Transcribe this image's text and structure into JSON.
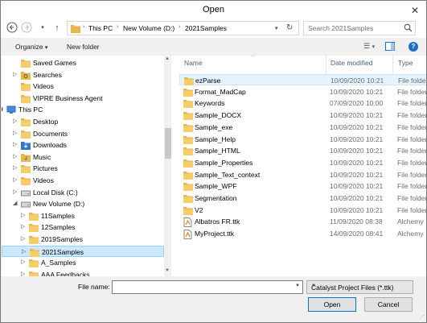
{
  "window": {
    "title": "Open"
  },
  "nav": {
    "breadcrumbs": [
      "This PC",
      "New Volume (D:)",
      "2021Samples"
    ],
    "search_placeholder": "Search 2021Samples"
  },
  "toolbar": {
    "organize_label": "Organize",
    "new_folder_label": "New folder"
  },
  "tree": {
    "items": [
      {
        "label": "Saved Games",
        "icon": "folder-icon",
        "indent": 2,
        "arrow": ""
      },
      {
        "label": "Searches",
        "icon": "search-folder-icon",
        "indent": 2,
        "arrow": "right"
      },
      {
        "label": "Videos",
        "icon": "folder-icon",
        "indent": 2,
        "arrow": ""
      },
      {
        "label": "VIPRE Business Agent",
        "icon": "folder-icon",
        "indent": 2,
        "arrow": ""
      },
      {
        "label": "This PC",
        "icon": "pc-icon",
        "indent": 1,
        "arrow": "down"
      },
      {
        "label": "Desktop",
        "icon": "folder-icon",
        "indent": 2,
        "arrow": "right"
      },
      {
        "label": "Documents",
        "icon": "folder-icon",
        "indent": 2,
        "arrow": "right"
      },
      {
        "label": "Downloads",
        "icon": "download-folder-icon",
        "indent": 2,
        "arrow": "right"
      },
      {
        "label": "Music",
        "icon": "music-folder-icon",
        "indent": 2,
        "arrow": "right"
      },
      {
        "label": "Pictures",
        "icon": "folder-icon",
        "indent": 2,
        "arrow": "right"
      },
      {
        "label": "Videos",
        "icon": "folder-icon",
        "indent": 2,
        "arrow": "right"
      },
      {
        "label": "Local Disk (C:)",
        "icon": "drive-icon",
        "indent": 2,
        "arrow": "right"
      },
      {
        "label": "New Volume (D:)",
        "icon": "drive-icon",
        "indent": 2,
        "arrow": "down"
      },
      {
        "label": "11Samples",
        "icon": "folder-icon",
        "indent": 3,
        "arrow": "right"
      },
      {
        "label": "12Samples",
        "icon": "folder-icon",
        "indent": 3,
        "arrow": "right"
      },
      {
        "label": "2019Samples",
        "icon": "folder-icon",
        "indent": 3,
        "arrow": "right"
      },
      {
        "label": "2021Samples",
        "icon": "folder-icon",
        "indent": 3,
        "arrow": "right",
        "selected": true
      },
      {
        "label": "A_Samples",
        "icon": "folder-icon",
        "indent": 3,
        "arrow": "right"
      },
      {
        "label": "AAA Feedbacks",
        "icon": "folder-icon",
        "indent": 3,
        "arrow": "right"
      }
    ]
  },
  "list": {
    "columns": [
      "Name",
      "Date modified",
      "Type"
    ],
    "files": [
      {
        "name": "ezParse",
        "date": "10/09/2020 10:21",
        "type": "File folder",
        "icon": "folder-icon",
        "selected": true
      },
      {
        "name": "Format_MadCap",
        "date": "10/09/2020 10:21",
        "type": "File folder",
        "icon": "folder-icon"
      },
      {
        "name": "Keywords",
        "date": "07/09/2020 10:00",
        "type": "File folder",
        "icon": "folder-icon"
      },
      {
        "name": "Sample_DOCX",
        "date": "10/09/2020 10:21",
        "type": "File folder",
        "icon": "folder-icon"
      },
      {
        "name": "Sample_exe",
        "date": "10/09/2020 10:21",
        "type": "File folder",
        "icon": "folder-icon"
      },
      {
        "name": "Sample_Help",
        "date": "10/09/2020 10:21",
        "type": "File folder",
        "icon": "folder-icon"
      },
      {
        "name": "Sample_HTML",
        "date": "10/09/2020 10:21",
        "type": "File folder",
        "icon": "folder-icon"
      },
      {
        "name": "Sample_Properties",
        "date": "10/09/2020 10:21",
        "type": "File folder",
        "icon": "folder-icon"
      },
      {
        "name": "Sample_Text_context",
        "date": "10/09/2020 10:21",
        "type": "File folder",
        "icon": "folder-icon"
      },
      {
        "name": "Sample_WPF",
        "date": "10/09/2020 10:21",
        "type": "File folder",
        "icon": "folder-icon"
      },
      {
        "name": "Segmentation",
        "date": "10/09/2020 10:21",
        "type": "File folder",
        "icon": "folder-icon"
      },
      {
        "name": "V2",
        "date": "10/09/2020 10:21",
        "type": "File folder",
        "icon": "folder-icon"
      },
      {
        "name": "Albatros FR.ttk",
        "date": "11/09/2020 08:38",
        "type": "Alchemy",
        "icon": "ttk-file-icon"
      },
      {
        "name": "MyProject.ttk",
        "date": "14/09/2020 08:41",
        "type": "Alchemy",
        "icon": "ttk-file-icon"
      }
    ]
  },
  "footer": {
    "file_name_label": "File name:",
    "file_name_value": "",
    "file_type_value": "Catalyst Project Files (*.ttk)",
    "open_label": "Open",
    "cancel_label": "Cancel"
  },
  "colors": {
    "folder": "#e8b64a",
    "selection": "#cce8ff",
    "accent": "#0078d7"
  }
}
